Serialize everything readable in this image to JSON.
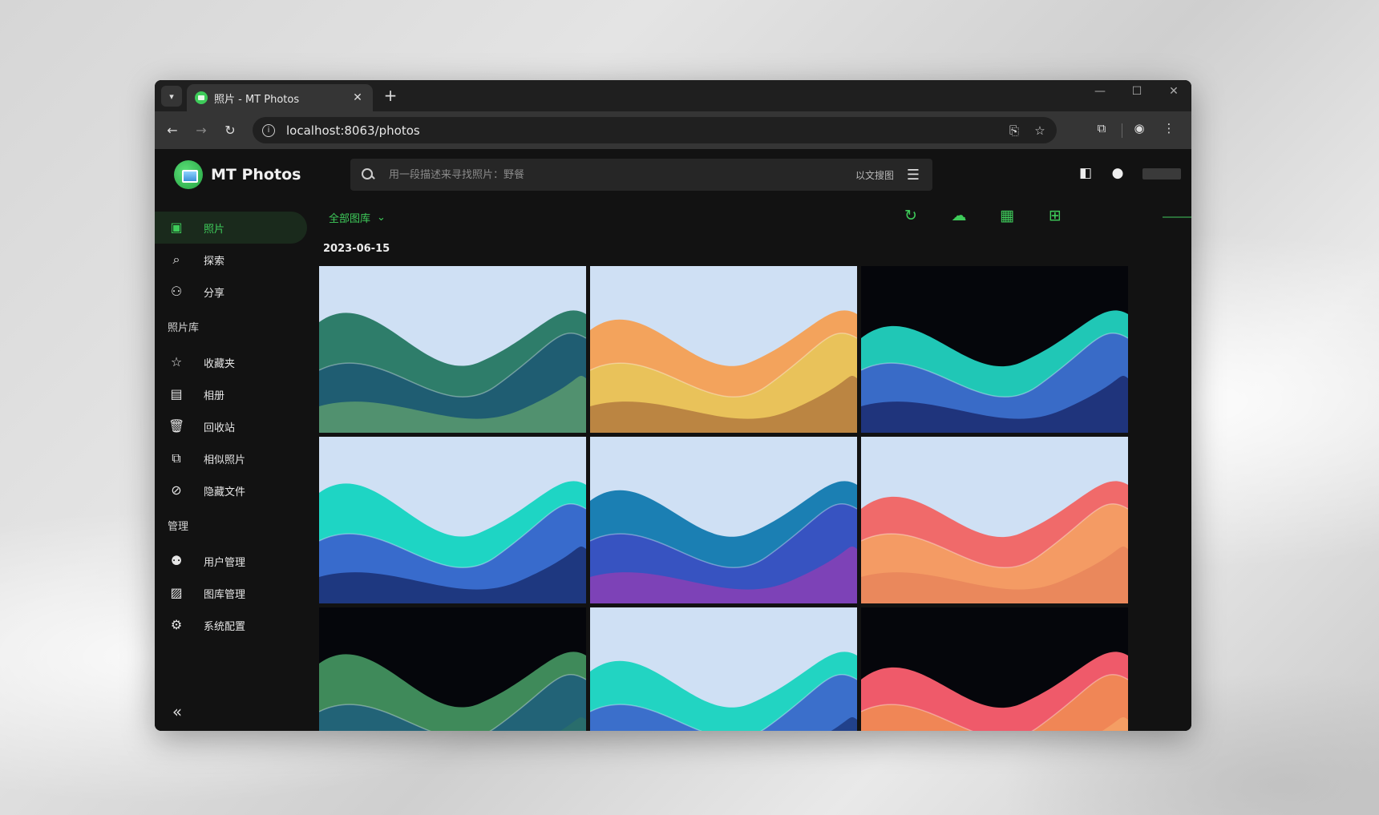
{
  "browser": {
    "tab_title": "照片 - MT Photos",
    "url": "localhost:8063/photos"
  },
  "app": {
    "brand": "MT Photos",
    "search": {
      "placeholder": "用一段描述来寻找照片：野餐",
      "image_search_label": "以文搜图"
    },
    "library_selector": "全部图库",
    "date_group": "2023-06-15"
  },
  "sidebar": {
    "primary": [
      {
        "label": "照片",
        "icon": "photo-icon",
        "active": true
      },
      {
        "label": "探索",
        "icon": "search-icon",
        "active": false
      },
      {
        "label": "分享",
        "icon": "people-icon",
        "active": false
      }
    ],
    "library_section": "照片库",
    "library": [
      {
        "label": "收藏夹",
        "icon": "star-icon"
      },
      {
        "label": "相册",
        "icon": "album-icon"
      },
      {
        "label": "回收站",
        "icon": "trash-icon"
      },
      {
        "label": "相似照片",
        "icon": "copy-icon"
      },
      {
        "label": "隐藏文件",
        "icon": "eye-off-icon"
      }
    ],
    "admin_section": "管理",
    "admin": [
      {
        "label": "用户管理",
        "icon": "user-manage-icon"
      },
      {
        "label": "图库管理",
        "icon": "gallery-manage-icon"
      },
      {
        "label": "系统配置",
        "icon": "gear-icon"
      }
    ]
  },
  "photos": [
    {
      "palette": [
        "#cfe0f4",
        "#2e7d6a",
        "#1e5a73",
        "#5a9a6e"
      ]
    },
    {
      "palette": [
        "#cfe0f4",
        "#f3a35c",
        "#e8c45a",
        "#b37a3e"
      ]
    },
    {
      "palette": [
        "#05060b",
        "#20c7b6",
        "#3c63c9",
        "#1b2a6e"
      ]
    },
    {
      "palette": [
        "#cfe0f4",
        "#1ed5c4",
        "#3b62cc",
        "#1a2f72"
      ]
    },
    {
      "palette": [
        "#cfe0f4",
        "#1b7fb3",
        "#3a4fc2",
        "#8a3fb5"
      ]
    },
    {
      "palette": [
        "#cfe0f4",
        "#f06a6a",
        "#f4a064",
        "#e8855a"
      ]
    },
    {
      "palette": [
        "#05060b",
        "#3f8a5a",
        "#1f5f7a",
        "#2a6f6a"
      ]
    },
    {
      "palette": [
        "#cfe0f4",
        "#22d4c2",
        "#3e66cc",
        "#1d3a80"
      ]
    },
    {
      "palette": [
        "#05060b",
        "#ef5a6a",
        "#f08a55",
        "#f4a266"
      ]
    }
  ],
  "colors": {
    "accent": "#3ecb5a"
  }
}
